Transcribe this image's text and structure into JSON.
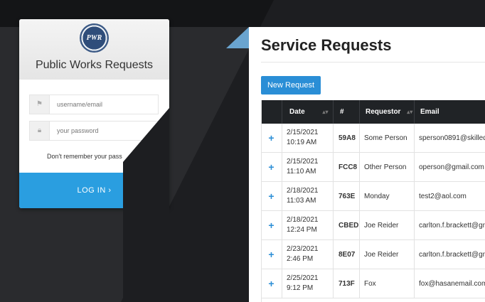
{
  "login": {
    "logo_text": "PWR",
    "title": "Public Works Requests",
    "username_placeholder": "username/email",
    "password_placeholder": "your password",
    "forgot_text": "Don't remember your pass",
    "login_label": "LOG IN ›"
  },
  "requests": {
    "title": "Service Requests",
    "new_button": "New Request",
    "columns": {
      "date": "Date",
      "id": "#",
      "requestor": "Requestor",
      "email": "Email"
    },
    "rows": [
      {
        "plus": "+",
        "date": "2/15/2021",
        "time": "10:19 AM",
        "id": "59A8",
        "requestor": "Some Person",
        "email": "sperson0891@skilledl"
      },
      {
        "plus": "+",
        "date": "2/15/2021",
        "time": "11:10 AM",
        "id": "FCC8",
        "requestor": "Other Person",
        "email": "operson@gmail.com"
      },
      {
        "plus": "+",
        "date": "2/18/2021",
        "time": "11:03 AM",
        "id": "763E",
        "requestor": "Monday",
        "email": "test2@aol.com"
      },
      {
        "plus": "+",
        "date": "2/18/2021",
        "time": "12:24 PM",
        "id": "CBED",
        "requestor": "Joe Reider",
        "email": "carlton.f.brackett@gn"
      },
      {
        "plus": "+",
        "date": "2/23/2021",
        "time": "2:46 PM",
        "id": "8E07",
        "requestor": "Joe Reider",
        "email": "carlton.f.brackett@gn"
      },
      {
        "plus": "+",
        "date": "2/25/2021",
        "time": "9:12 PM",
        "id": "713F",
        "requestor": "Fox",
        "email": "fox@hasanemail.com"
      }
    ]
  }
}
